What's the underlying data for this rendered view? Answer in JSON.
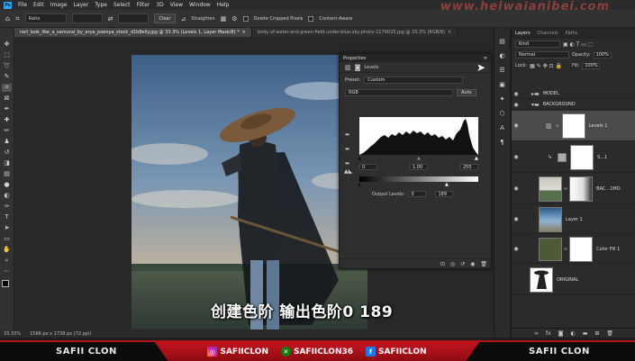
{
  "app": {
    "logo": "Ps"
  },
  "menu": [
    "File",
    "Edit",
    "Image",
    "Layer",
    "Type",
    "Select",
    "Filter",
    "3D",
    "View",
    "Window",
    "Help"
  ],
  "watermark": "www.heiwaianibei.com",
  "options": {
    "ratio_label": "Ratio",
    "clear_label": "Clear",
    "straighten_label": "Straighten",
    "delete_cropped_label": "Delete Cropped Pixels",
    "content_aware_label": "Content-Aware"
  },
  "tabs": [
    {
      "label": "neil_look_like_a_samurai_by_arya_poenya_stock_d1b8elly.jpg @ 33.3% (Levels 1, Layer Mask/8) *"
    },
    {
      "label": "body-of-water-and-green-field-under-blue-sky-photo-1179025.jpg @ 33.3% (RGB/8)"
    }
  ],
  "status": {
    "zoom": "33.33%",
    "doc": "1566 px x 1738 px (72 ppi)"
  },
  "subtitle": "创建色阶 输出色阶0 189",
  "properties": {
    "title": "Properties",
    "adjustment": "Levels",
    "preset_label": "Preset:",
    "preset_value": "Custom",
    "channel": "RGB",
    "auto_label": "Auto",
    "input_black": "0",
    "input_gamma": "1.00",
    "input_white": "255",
    "output_label": "Output Levels:",
    "output_black": "0",
    "output_white": "189"
  },
  "layers_panel": {
    "tabs": [
      "Layers",
      "Channels",
      "Paths"
    ],
    "kind_label": "Kind",
    "blend_mode": "Normal",
    "opacity_label": "Opacity:",
    "opacity": "100%",
    "lock_label": "Lock:",
    "fill_label": "Fill:",
    "fill": "100%",
    "layers": [
      {
        "name": "MODEL",
        "type": "group"
      },
      {
        "name": "BACKGROUND",
        "type": "group"
      },
      {
        "name": "Levels 1",
        "type": "adjust",
        "selected": true
      },
      {
        "name": "S...1",
        "type": "mask"
      },
      {
        "name": "BAC...1MO",
        "type": "photo"
      },
      {
        "name": "Layer 1",
        "type": "sky"
      },
      {
        "name": "Color Fill 1",
        "type": "fill"
      },
      {
        "name": "ORIGINAL",
        "type": "original"
      }
    ]
  },
  "banner": {
    "left": "SAFII CLON",
    "right": "SAFII CLON",
    "instagram": "SAFIICLON",
    "xbox": "SAFIICLON36",
    "facebook": "SAFIICLON"
  },
  "colors": {
    "accent": "#31a8ff",
    "banner_red": "#c4141e"
  }
}
